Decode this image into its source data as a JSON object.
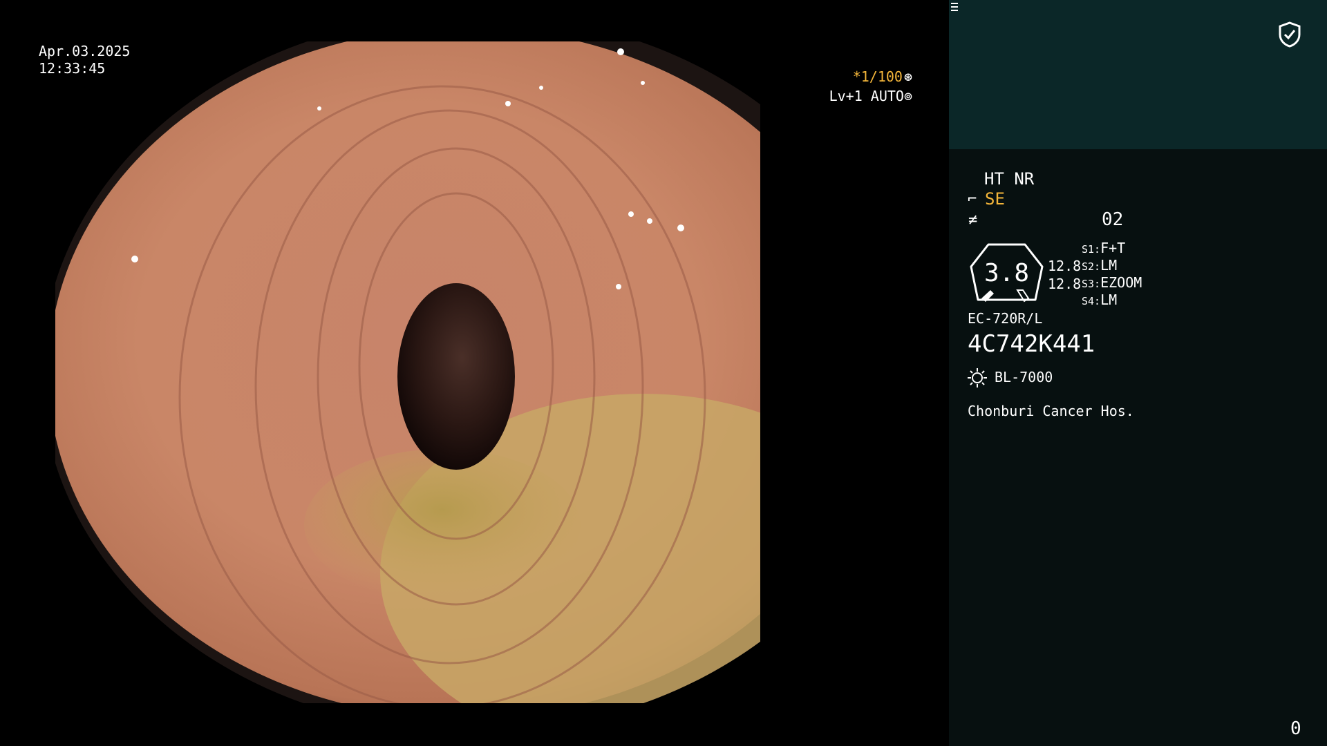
{
  "viewport": {
    "date": "Apr.03.2025",
    "time": "12:33:45",
    "shutter_speed": "*1/100",
    "iris_icon": "aperture-icon",
    "level": "Lv+1 AUTO",
    "brightness_icon": "brightness-icon"
  },
  "panel": {
    "top_icon": "shield-check-icon",
    "mode": "HT NR",
    "enhance_icon": "structure-enhance-icon",
    "enhance": "SE",
    "color_icon": "color-tone-icon",
    "memo_icon": "memory-icon",
    "memo_value": "02",
    "dial_icon": "scope-dial-icon",
    "dial_value": "3.8",
    "value_1": "12.8",
    "value_2": "12.8",
    "switches": [
      {
        "tag": "S1:",
        "value": "F+T"
      },
      {
        "tag": "S2:",
        "value": "LM"
      },
      {
        "tag": "S3:",
        "value": "EZOOM"
      },
      {
        "tag": "S4:",
        "value": "LM"
      }
    ],
    "scope_model": "EC-720R/L",
    "serial": "4C742K441",
    "light_icon": "light-source-icon",
    "light_source": "BL-7000",
    "hospital": "Chonburi Cancer Hos.",
    "counter": "0"
  },
  "colors": {
    "panel_bg": "#071010",
    "panel_top_bg": "#0b2728",
    "accent": "#f4b63a"
  }
}
